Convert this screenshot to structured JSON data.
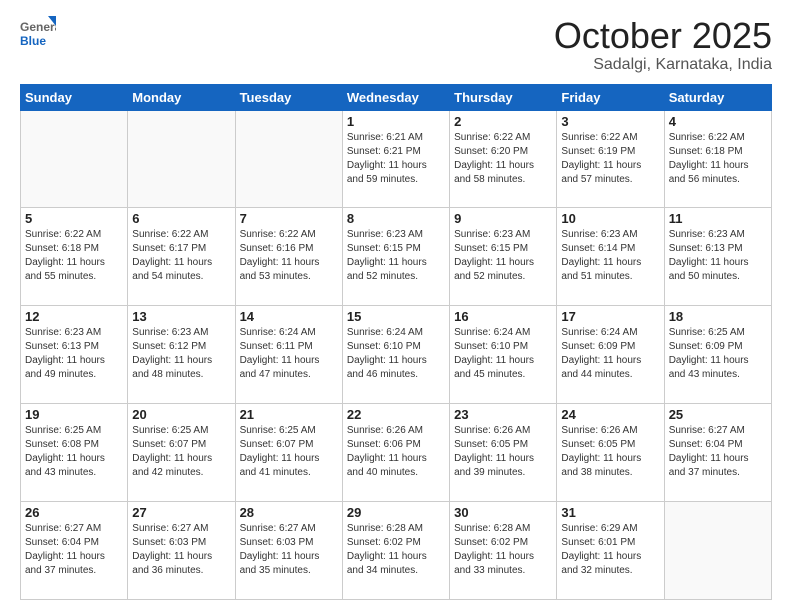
{
  "header": {
    "logo_general": "General",
    "logo_blue": "Blue",
    "title": "October 2025",
    "subtitle": "Sadalgi, Karnataka, India"
  },
  "calendar": {
    "days_of_week": [
      "Sunday",
      "Monday",
      "Tuesday",
      "Wednesday",
      "Thursday",
      "Friday",
      "Saturday"
    ],
    "weeks": [
      [
        {
          "day": null,
          "info": null
        },
        {
          "day": null,
          "info": null
        },
        {
          "day": null,
          "info": null
        },
        {
          "day": "1",
          "info": "Sunrise: 6:21 AM\nSunset: 6:21 PM\nDaylight: 11 hours\nand 59 minutes."
        },
        {
          "day": "2",
          "info": "Sunrise: 6:22 AM\nSunset: 6:20 PM\nDaylight: 11 hours\nand 58 minutes."
        },
        {
          "day": "3",
          "info": "Sunrise: 6:22 AM\nSunset: 6:19 PM\nDaylight: 11 hours\nand 57 minutes."
        },
        {
          "day": "4",
          "info": "Sunrise: 6:22 AM\nSunset: 6:18 PM\nDaylight: 11 hours\nand 56 minutes."
        }
      ],
      [
        {
          "day": "5",
          "info": "Sunrise: 6:22 AM\nSunset: 6:18 PM\nDaylight: 11 hours\nand 55 minutes."
        },
        {
          "day": "6",
          "info": "Sunrise: 6:22 AM\nSunset: 6:17 PM\nDaylight: 11 hours\nand 54 minutes."
        },
        {
          "day": "7",
          "info": "Sunrise: 6:22 AM\nSunset: 6:16 PM\nDaylight: 11 hours\nand 53 minutes."
        },
        {
          "day": "8",
          "info": "Sunrise: 6:23 AM\nSunset: 6:15 PM\nDaylight: 11 hours\nand 52 minutes."
        },
        {
          "day": "9",
          "info": "Sunrise: 6:23 AM\nSunset: 6:15 PM\nDaylight: 11 hours\nand 52 minutes."
        },
        {
          "day": "10",
          "info": "Sunrise: 6:23 AM\nSunset: 6:14 PM\nDaylight: 11 hours\nand 51 minutes."
        },
        {
          "day": "11",
          "info": "Sunrise: 6:23 AM\nSunset: 6:13 PM\nDaylight: 11 hours\nand 50 minutes."
        }
      ],
      [
        {
          "day": "12",
          "info": "Sunrise: 6:23 AM\nSunset: 6:13 PM\nDaylight: 11 hours\nand 49 minutes."
        },
        {
          "day": "13",
          "info": "Sunrise: 6:23 AM\nSunset: 6:12 PM\nDaylight: 11 hours\nand 48 minutes."
        },
        {
          "day": "14",
          "info": "Sunrise: 6:24 AM\nSunset: 6:11 PM\nDaylight: 11 hours\nand 47 minutes."
        },
        {
          "day": "15",
          "info": "Sunrise: 6:24 AM\nSunset: 6:10 PM\nDaylight: 11 hours\nand 46 minutes."
        },
        {
          "day": "16",
          "info": "Sunrise: 6:24 AM\nSunset: 6:10 PM\nDaylight: 11 hours\nand 45 minutes."
        },
        {
          "day": "17",
          "info": "Sunrise: 6:24 AM\nSunset: 6:09 PM\nDaylight: 11 hours\nand 44 minutes."
        },
        {
          "day": "18",
          "info": "Sunrise: 6:25 AM\nSunset: 6:09 PM\nDaylight: 11 hours\nand 43 minutes."
        }
      ],
      [
        {
          "day": "19",
          "info": "Sunrise: 6:25 AM\nSunset: 6:08 PM\nDaylight: 11 hours\nand 43 minutes."
        },
        {
          "day": "20",
          "info": "Sunrise: 6:25 AM\nSunset: 6:07 PM\nDaylight: 11 hours\nand 42 minutes."
        },
        {
          "day": "21",
          "info": "Sunrise: 6:25 AM\nSunset: 6:07 PM\nDaylight: 11 hours\nand 41 minutes."
        },
        {
          "day": "22",
          "info": "Sunrise: 6:26 AM\nSunset: 6:06 PM\nDaylight: 11 hours\nand 40 minutes."
        },
        {
          "day": "23",
          "info": "Sunrise: 6:26 AM\nSunset: 6:05 PM\nDaylight: 11 hours\nand 39 minutes."
        },
        {
          "day": "24",
          "info": "Sunrise: 6:26 AM\nSunset: 6:05 PM\nDaylight: 11 hours\nand 38 minutes."
        },
        {
          "day": "25",
          "info": "Sunrise: 6:27 AM\nSunset: 6:04 PM\nDaylight: 11 hours\nand 37 minutes."
        }
      ],
      [
        {
          "day": "26",
          "info": "Sunrise: 6:27 AM\nSunset: 6:04 PM\nDaylight: 11 hours\nand 37 minutes."
        },
        {
          "day": "27",
          "info": "Sunrise: 6:27 AM\nSunset: 6:03 PM\nDaylight: 11 hours\nand 36 minutes."
        },
        {
          "day": "28",
          "info": "Sunrise: 6:27 AM\nSunset: 6:03 PM\nDaylight: 11 hours\nand 35 minutes."
        },
        {
          "day": "29",
          "info": "Sunrise: 6:28 AM\nSunset: 6:02 PM\nDaylight: 11 hours\nand 34 minutes."
        },
        {
          "day": "30",
          "info": "Sunrise: 6:28 AM\nSunset: 6:02 PM\nDaylight: 11 hours\nand 33 minutes."
        },
        {
          "day": "31",
          "info": "Sunrise: 6:29 AM\nSunset: 6:01 PM\nDaylight: 11 hours\nand 32 minutes."
        },
        {
          "day": null,
          "info": null
        }
      ]
    ]
  }
}
